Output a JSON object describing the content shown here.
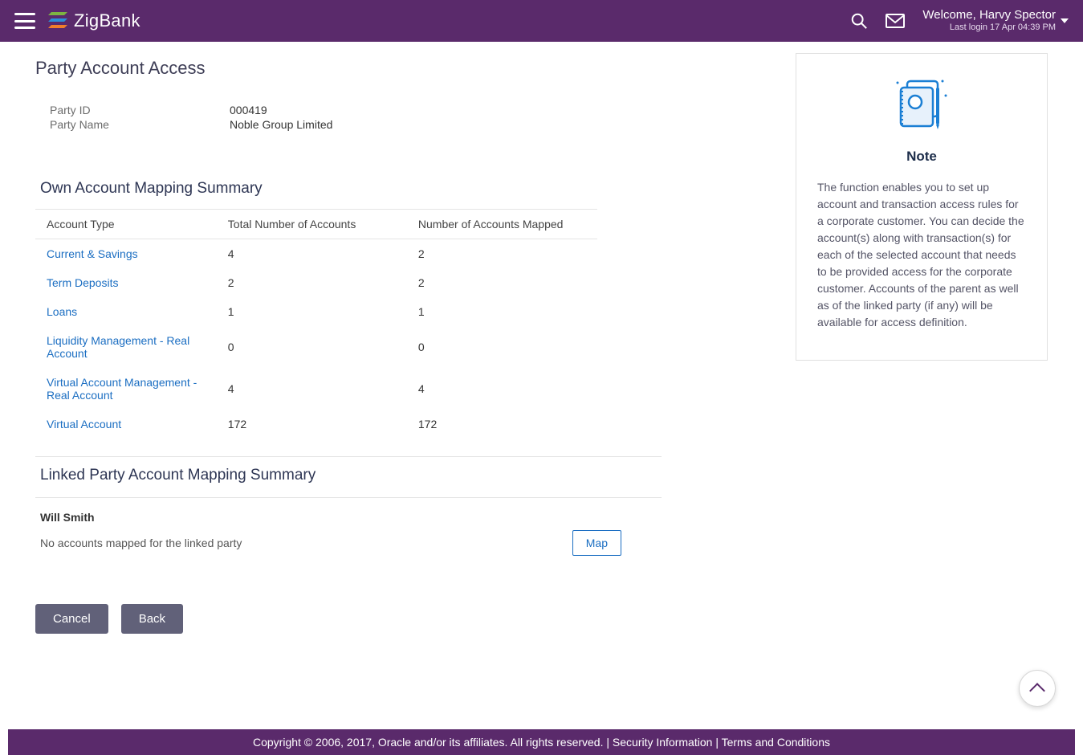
{
  "header": {
    "brand": "ZigBank",
    "welcome": "Welcome, Harvy Spector",
    "last_login": "Last login 17 Apr 04:39 PM"
  },
  "page": {
    "title": "Party Account Access"
  },
  "party": {
    "id_label": "Party ID",
    "id_value": "000419",
    "name_label": "Party Name",
    "name_value": "Noble Group Limited"
  },
  "own_summary": {
    "title": "Own Account Mapping Summary",
    "cols": {
      "type": "Account Type",
      "total": "Total Number of Accounts",
      "mapped": "Number of Accounts Mapped"
    },
    "rows": [
      {
        "type": "Current & Savings",
        "total": "4",
        "mapped": "2"
      },
      {
        "type": "Term Deposits",
        "total": "2",
        "mapped": "2"
      },
      {
        "type": "Loans",
        "total": "1",
        "mapped": "1"
      },
      {
        "type": "Liquidity Management - Real Account",
        "total": "0",
        "mapped": "0"
      },
      {
        "type": "Virtual Account Management - Real Account",
        "total": "4",
        "mapped": "4"
      },
      {
        "type": "Virtual Account",
        "total": "172",
        "mapped": "172"
      }
    ]
  },
  "linked_summary": {
    "title": "Linked Party Account Mapping Summary",
    "party_name": "Will Smith",
    "message": "No accounts mapped for the linked party",
    "map_label": "Map"
  },
  "actions": {
    "cancel": "Cancel",
    "back": "Back"
  },
  "note": {
    "title": "Note",
    "text": "The function enables you to set up account and transaction access rules for a corporate customer. You can decide the account(s) along with transaction(s) for each of the selected account that needs to be provided access for the corporate customer. Accounts of the parent as well as of the linked party (if any) will be available for access definition."
  },
  "footer": {
    "copyright": "Copyright © 2006, 2017, Oracle and/or its affiliates. All rights reserved.",
    "security": "Security Information",
    "terms": "Terms and Conditions"
  }
}
